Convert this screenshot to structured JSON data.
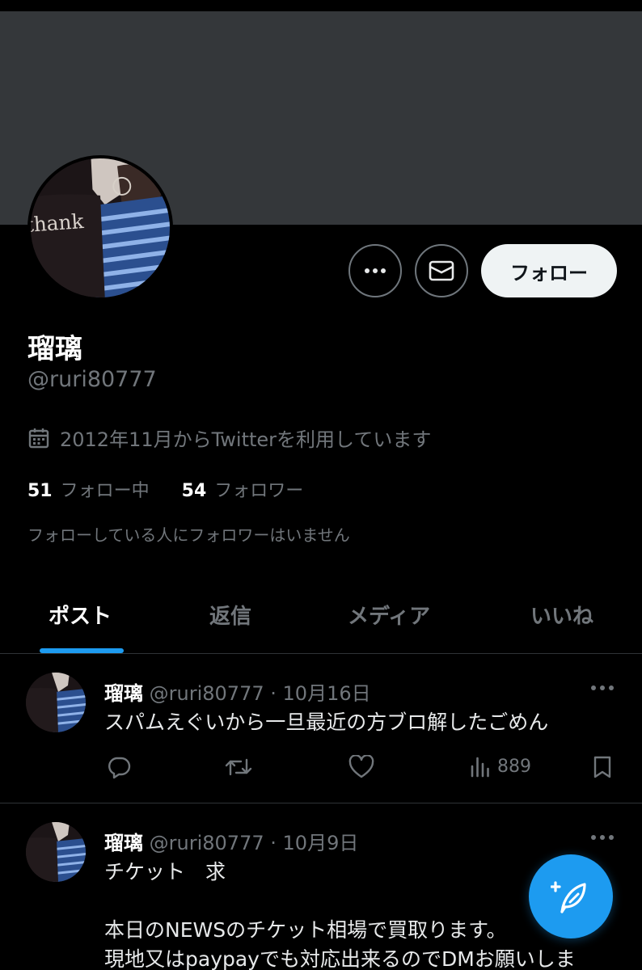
{
  "colors": {
    "background": "#000000",
    "banner": "#34373a",
    "accent": "#1d9bf0",
    "text_primary": "#e7e9ea",
    "text_secondary": "#71767b",
    "follow_button_bg": "#eff3f4",
    "divider": "#2f3336"
  },
  "profile": {
    "avatar_shirt_text": "thank",
    "name": "瑠璃",
    "handle": "@ruri80777",
    "joined": "2012年11月からTwitterを利用しています",
    "following_count": "51",
    "following_label": "フォロー中",
    "followers_count": "54",
    "followers_label": "フォロワー",
    "mutual_note": "フォローしている人にフォロワーはいません"
  },
  "buttons": {
    "more_icon": "ellipsis-icon",
    "message_icon": "envelope-icon",
    "follow_label": "フォロー"
  },
  "tabs": [
    {
      "label": "ポスト",
      "active": true
    },
    {
      "label": "返信",
      "active": false
    },
    {
      "label": "メディア",
      "active": false
    },
    {
      "label": "いいね",
      "active": false
    }
  ],
  "tweets": [
    {
      "name": "瑠璃",
      "handle": "@ruri80777",
      "separator": "·",
      "date": "10月16日",
      "lines": [
        "スパムえぐいから一旦最近の方ブロ解したごめん"
      ],
      "views": "889"
    },
    {
      "name": "瑠璃",
      "handle": "@ruri80777",
      "separator": "·",
      "date": "10月9日",
      "lines": [
        "チケット　求",
        "",
        "本日のNEWSのチケット相場で買取ります。",
        "現地又はpaypayでも対応出来るのでDMお願いしま"
      ]
    }
  ],
  "icons": {
    "reply": "reply-icon",
    "repost": "repost-icon",
    "like": "heart-icon",
    "views": "views-icon",
    "bookmark": "bookmark-icon",
    "compose": "compose-post-icon",
    "calendar": "calendar-icon"
  }
}
